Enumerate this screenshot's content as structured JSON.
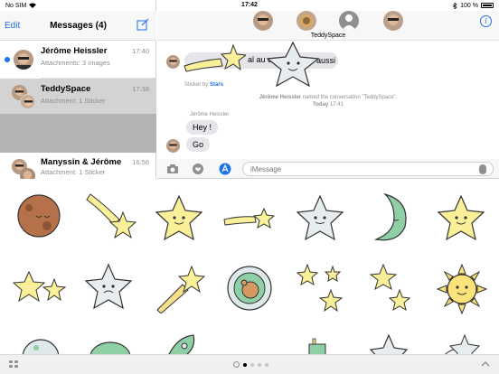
{
  "status_bar": {
    "carrier": "No SIM",
    "time": "17:42",
    "battery": "100 %"
  },
  "list": {
    "edit_label": "Edit",
    "title": "Messages (4)",
    "conversations": [
      {
        "name": "Jérôme Heissler",
        "time": "17:40",
        "preview": "Attachments: 3 Images",
        "unread": true
      },
      {
        "name": "TeddySpace",
        "time": "17:38",
        "preview": "Attachment: 1 Sticker",
        "selected": true
      },
      {
        "name": "Manyssin & Jérôme",
        "time": "16:56",
        "preview": "Attachment: 1 Sticker"
      }
    ]
  },
  "conversation": {
    "name": "TeddySpace",
    "partial_message_left": "al au cr",
    "partial_message_right": "aussi",
    "sticker_by_prefix": "Sticker by",
    "sticker_by_app": "Stars",
    "system_message_name": "Jérôme Heissler",
    "system_message_text": "named the conversation \"TeddySpace\".",
    "system_message_day": "Today",
    "system_message_time": "17:41",
    "sender": "Jérôme Heissler",
    "messages": [
      "Hey !",
      "Go"
    ]
  },
  "input": {
    "placeholder": "iMessage"
  },
  "colors": {
    "accent": "#1a73e8",
    "star_yellow": "#fbf09a",
    "star_gray": "#e7ecef",
    "moon_green": "#8fcfa6"
  },
  "icons": {
    "compose": "compose-icon",
    "info": "info-icon",
    "camera": "camera-icon",
    "digital_touch": "heart-hand-icon",
    "app_store": "app-store-icon",
    "mic": "microphone-icon",
    "apps": "apps-grid-icon",
    "collapse": "chevron-up-icon"
  }
}
